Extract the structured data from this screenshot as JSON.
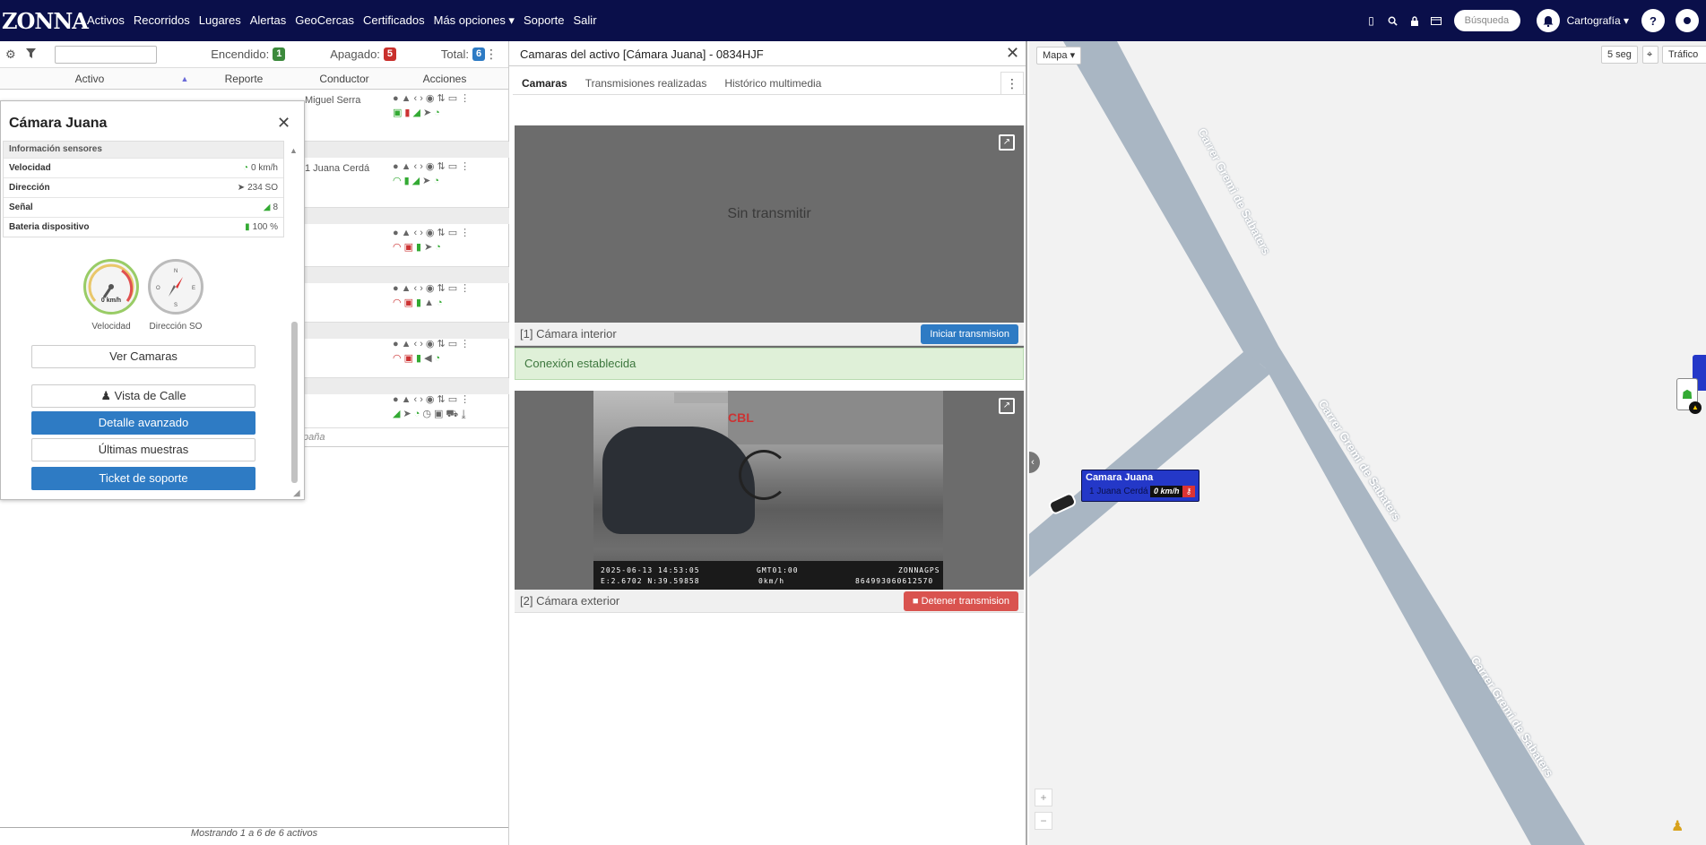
{
  "app": {
    "logo": "ZONNA"
  },
  "nav": {
    "items": [
      "Activos",
      "Recorridos",
      "Lugares",
      "Alertas",
      "GeoCercas",
      "Certificados",
      "Más opciones ▾",
      "Soporte",
      "Salir"
    ],
    "search_placeholder": "Búsqueda",
    "cartography": "Cartografía ▾",
    "help": "?"
  },
  "assets": {
    "toolbar": {
      "on_label": "Encendido:",
      "on_count": "1",
      "off_label": "Apagado:",
      "off_count": "5",
      "total_label": "Total:",
      "total_count": "6"
    },
    "columns": [
      "Activo",
      "Reporte",
      "Conductor",
      "Acciones"
    ],
    "rows": [
      {
        "driver": "Miguel Serra"
      },
      {
        "driver": "1 Juana Cerdá"
      },
      {
        "driver": ""
      },
      {
        "driver": ""
      },
      {
        "driver": ""
      },
      {
        "driver": ""
      }
    ],
    "partial_text": "paña",
    "footer": "Mostrando 1 a 6 de 6 activos"
  },
  "popup": {
    "title": "Cámara Juana",
    "sensors_header": "Información sensores",
    "sensors": [
      {
        "key": "Velocidad",
        "value": "0 km/h"
      },
      {
        "key": "Dirección",
        "value": "234 SO"
      },
      {
        "key": "Señal",
        "value": "8"
      },
      {
        "key": "Bateria dispositivo",
        "value": "100 %"
      }
    ],
    "gauge_speed_value": "0 km/h",
    "gauge_speed_label": "Velocidad",
    "gauge_dir_label": "Dirección SO",
    "buttons": {
      "cameras": "Ver Camaras",
      "street": "Vista de Calle",
      "advanced": "Detalle avanzado",
      "samples": "Últimas muestras",
      "ticket": "Ticket de soporte"
    }
  },
  "camera": {
    "title": "Camaras del activo [Cámara Juana] - 0834HJF",
    "tabs": [
      "Camaras",
      "Transmisiones realizadas",
      "Histórico multimedia"
    ],
    "cam1": {
      "status": "Sin transmitir",
      "label": "[1] Cámara interior",
      "button": "Iniciar transmision"
    },
    "connection": "Conexión establecida",
    "cam2": {
      "label": "[2] Cámara exterior",
      "button": "Detener transmision",
      "osd_datetime": "2025-06-13  14:53:05",
      "osd_coords": "E:2.6702  N:39.59858",
      "osd_gmt": "GMT01:00",
      "osd_speed": "0km/h",
      "osd_brand": "ZONNAGPS",
      "osd_id": "864993060612570",
      "sign_text": "CBL"
    }
  },
  "map": {
    "type_button": "Mapa ▾",
    "refresh": "5 seg",
    "traffic": "Tráfico",
    "roads": [
      "Carrer Gremi de Sabaters",
      "Carrer Gremi de Sabaters",
      "Carrer Gremi de Sabaters"
    ],
    "marker": {
      "title": "Camara Juana",
      "driver": "1 Juana Cerdá",
      "speed": "0 km/h"
    }
  },
  "colors": {
    "nav_bg": "#0a0f4a",
    "green": "#3c8a3c",
    "red": "#c9302c",
    "blue": "#2e7bc4",
    "road": "#a9b6c3"
  }
}
